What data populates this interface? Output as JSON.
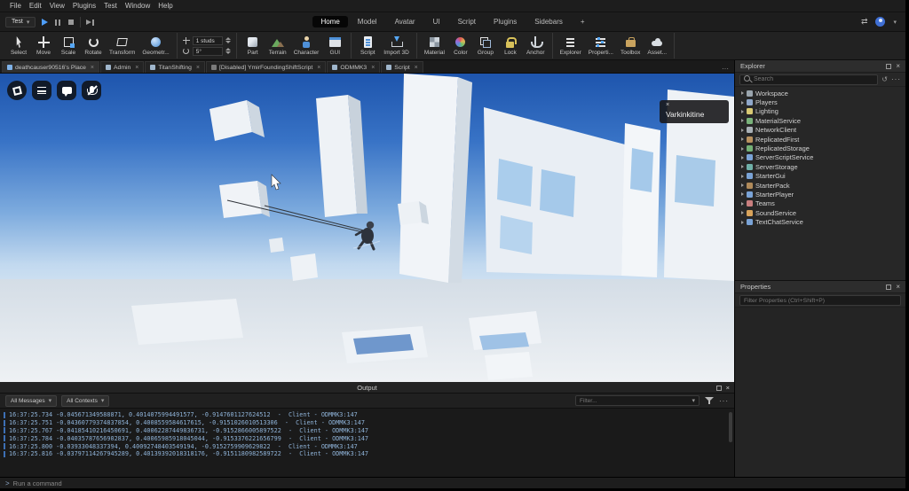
{
  "icons": {
    "close": "×",
    "chevron_down": "▾",
    "history": "↺",
    "dots": "···",
    "swap": "⇄",
    "prompt": ">"
  },
  "menu_bar": {
    "items": [
      "File",
      "Edit",
      "View",
      "Plugins",
      "Test",
      "Window",
      "Help"
    ]
  },
  "playback": {
    "preset": "Test"
  },
  "ribbon": {
    "tabs": [
      {
        "label": "Home",
        "active": true
      },
      {
        "label": "Model"
      },
      {
        "label": "Avatar"
      },
      {
        "label": "UI"
      },
      {
        "label": "Script"
      },
      {
        "label": "Plugins"
      },
      {
        "label": "Sidebars"
      },
      {
        "label": "+"
      }
    ]
  },
  "toolbar": {
    "groups": {
      "g1": [
        {
          "label": "Select",
          "icon": "select"
        },
        {
          "label": "Move",
          "icon": "move"
        },
        {
          "label": "Scale",
          "icon": "scale"
        },
        {
          "label": "Rotate",
          "icon": "rotate"
        },
        {
          "label": "Transform",
          "icon": "transform"
        },
        {
          "label": "Geometr...",
          "icon": "geometry"
        }
      ],
      "g2": [
        {
          "label": "Part",
          "icon": "part"
        },
        {
          "label": "Terrain",
          "icon": "terrain"
        },
        {
          "label": "Character",
          "icon": "character"
        },
        {
          "label": "GUI",
          "icon": "gui"
        }
      ],
      "g3": [
        {
          "label": "Script",
          "icon": "script"
        },
        {
          "label": "Import 3D",
          "icon": "import"
        }
      ],
      "g4": [
        {
          "label": "Material",
          "icon": "material"
        },
        {
          "label": "Color",
          "icon": "color"
        },
        {
          "label": "Group",
          "icon": "group"
        },
        {
          "label": "Lock",
          "icon": "lock"
        },
        {
          "label": "Anchor",
          "icon": "anchor"
        }
      ],
      "g5": [
        {
          "label": "Explorer",
          "icon": "explorer"
        },
        {
          "label": "Properti...",
          "icon": "properties"
        },
        {
          "label": "Toolbox",
          "icon": "toolbox"
        },
        {
          "label": "Asset...",
          "icon": "asset"
        }
      ]
    },
    "snap": {
      "move_value": "1 studs",
      "rotate_value": "5°"
    }
  },
  "doc_tabs": [
    {
      "label": "deathcauser90516's Place",
      "color": "#7fb2e8",
      "active": true
    },
    {
      "label": "Admin",
      "color": "#9fb6cc"
    },
    {
      "label": "TitanShifting",
      "color": "#9fb6cc"
    },
    {
      "label": "[Disabled] YmirFoundingShiftScript",
      "color": "#7b7b7b"
    },
    {
      "label": "ODMMK3",
      "color": "#9fb6cc"
    },
    {
      "label": "Script",
      "color": "#9fb6cc"
    }
  ],
  "viewport": {
    "tooltip": {
      "title": "Varkinkitine"
    }
  },
  "explorer": {
    "title": "Explorer",
    "search_placeholder": "Search",
    "items": [
      {
        "label": "Workspace",
        "color": "#9aa5ad"
      },
      {
        "label": "Players",
        "color": "#8fa7c9"
      },
      {
        "label": "Lighting",
        "color": "#d8c973"
      },
      {
        "label": "MaterialService",
        "color": "#79b27a"
      },
      {
        "label": "NetworkClient",
        "color": "#a9b0b6"
      },
      {
        "label": "ReplicatedFirst",
        "color": "#b9925f"
      },
      {
        "label": "ReplicatedStorage",
        "color": "#74b176"
      },
      {
        "label": "ServerScriptService",
        "color": "#7aa3d6"
      },
      {
        "label": "ServerStorage",
        "color": "#6fb0a8"
      },
      {
        "label": "StarterGui",
        "color": "#7aa3d6"
      },
      {
        "label": "StarterPack",
        "color": "#b08a5a"
      },
      {
        "label": "StarterPlayer",
        "color": "#7aa3d6"
      },
      {
        "label": "Teams",
        "color": "#c97f7f"
      },
      {
        "label": "SoundService",
        "color": "#d8a35b"
      },
      {
        "label": "TextChatService",
        "color": "#7aa3d6"
      }
    ]
  },
  "properties": {
    "title": "Properties",
    "filter_placeholder": "Filter Properties (Ctrl+Shift+P)"
  },
  "output": {
    "title": "Output",
    "messages_dropdown": "All Messages",
    "contexts_dropdown": "All Contexts",
    "filter_placeholder": "Filter...",
    "lines": [
      {
        "t": "16:37:25.734",
        "m": "-0.045671349588871, 0.4014075994491577, -0.9147601127624512  -  Client - ODMMK3:147"
      },
      {
        "t": "16:37:25.751",
        "m": "-0.04360779374837854, 0.4008559584617615, -0.9151026010513306  -  Client - ODMMK3:147"
      },
      {
        "t": "16:37:25.767",
        "m": "-0.04185410216450691, 0.40062287449836731, -0.9152866005897522  -  Client - ODMMK3:147"
      },
      {
        "t": "16:37:25.784",
        "m": "-0.04035787656902837, 0.40065985918045044, -0.9153376221656799  -  Client - ODMMK3:147"
      },
      {
        "t": "16:37:25.800",
        "m": "-0.03933048337394, 0.40092748403549194, -0.9152759909629822  -  Client - ODMMK3:147"
      },
      {
        "t": "16:37:25.816",
        "m": "-0.03797114267945289, 0.40139392018318176, -0.9151180982589722  -  Client - ODMMK3:147"
      }
    ]
  },
  "command_bar": {
    "placeholder": "Run a command"
  }
}
